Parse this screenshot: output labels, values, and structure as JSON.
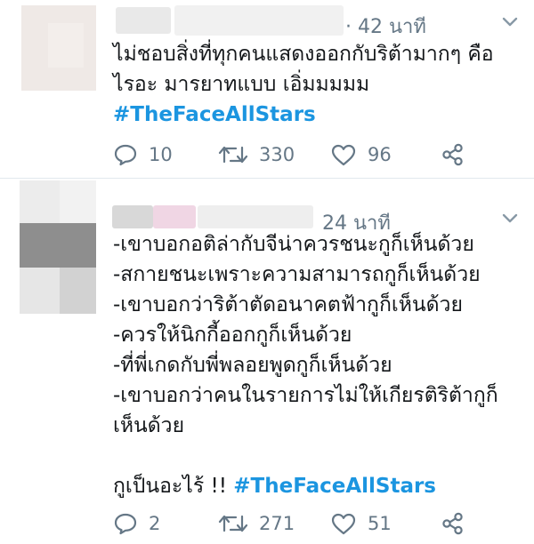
{
  "tweets": [
    {
      "time": "· 42 นาที",
      "lines": [
        "ไม่ชอบสิ่งที่ทุกคนแสดงออกกับริต้ามากๆ คือ",
        "ไรอะ มารยาทแบบ เอิ่มมมมม"
      ],
      "hashtag": "#TheFaceAllStars",
      "actions": {
        "reply_count": "10",
        "retweet_count": "330",
        "like_count": "96"
      }
    },
    {
      "time": "24 นาที",
      "lines": [
        "-เขาบอกอติล่ากับจีน่าควรชนะกูก็เห็นด้วย",
        "-สกายชนะเพราะความสามารถกูก็เห็นด้วย",
        "-เขาบอกว่าริต้าตัดอนาคตฟ้ากูก็เห็นด้วย",
        "-ควรให้นิกกี้ออกกูก็เห็นด้วย",
        "-ที่พี่เกดกับพี่พลอยพูดกูก็เห็นด้วย",
        "-เขาบอกว่าคนในรายการไม่ให้เกียรติริต้ากูก็",
        "เห็นด้วย"
      ],
      "closing": "กูเป็นอะไร้ !! ",
      "hashtag": "#TheFaceAllStars",
      "actions": {
        "reply_count": "2",
        "retweet_count": "271",
        "like_count": "51"
      }
    }
  ],
  "colors": {
    "text": "#14171a",
    "muted": "#657786",
    "hashtag": "#1b95e0",
    "divider": "#e1e8ed"
  },
  "icons": [
    "reply-icon",
    "retweet-icon",
    "like-icon",
    "share-icon",
    "chevron-down-icon"
  ]
}
